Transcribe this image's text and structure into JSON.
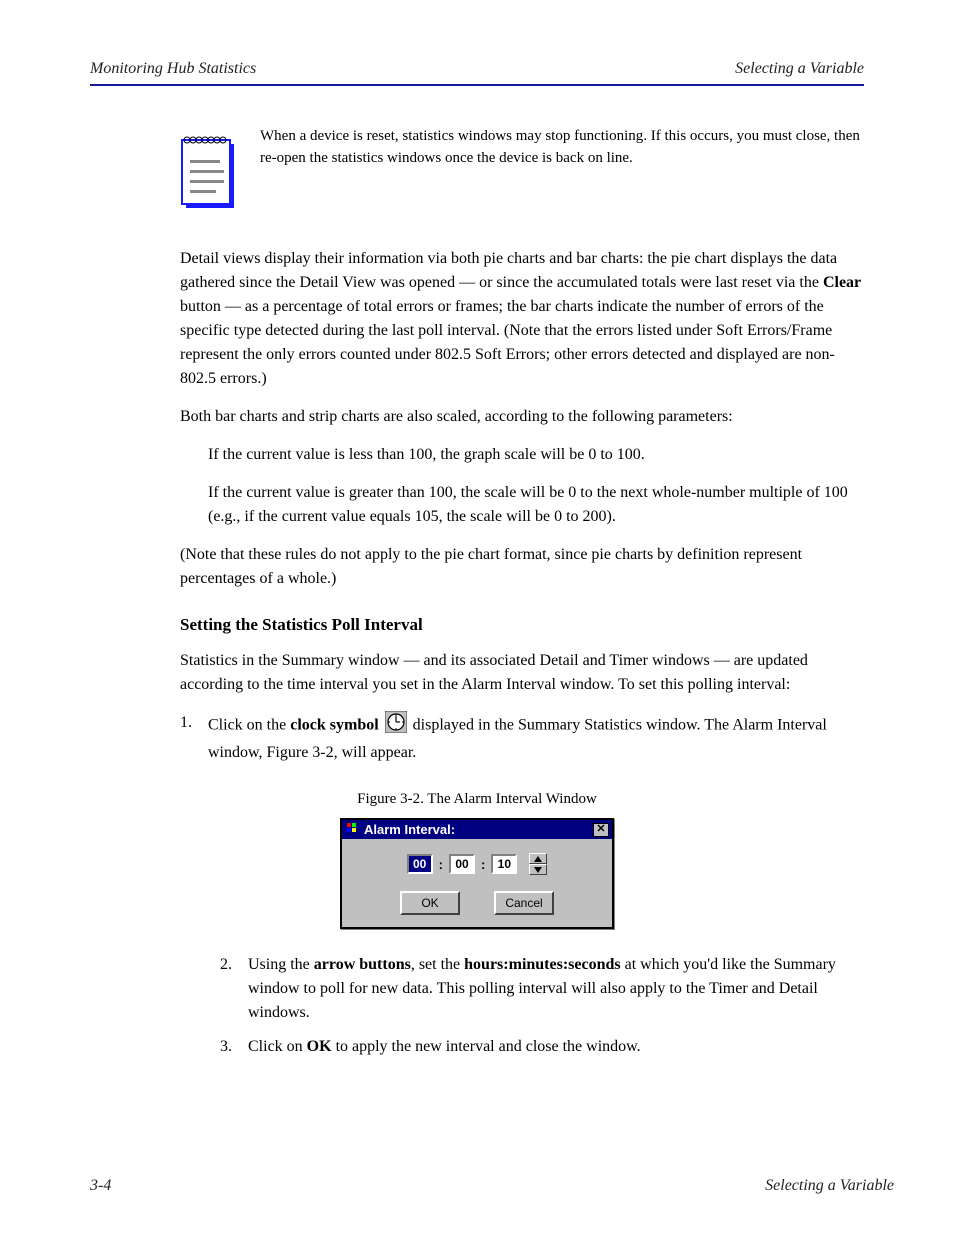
{
  "header": {
    "left": "Monitoring Hub Statistics",
    "right": "Selecting a Variable"
  },
  "note": "When a device is reset, statistics windows may stop functioning. If this occurs, you must close, then re-open the statistics windows once the device is back on line.",
  "detail_para": {
    "pre": "Detail views display their information via both pie charts and bar charts: the pie chart displays the data gathered since the Detail View was opened — or since the accumulated totals were last reset via the ",
    "bold": "Clear",
    "post": " button — as a percentage of total errors or frames; the bar charts indicate the number of errors of the specific type detected during the last poll interval. (Note that the errors listed under Soft Errors/Frame represent the only errors counted under 802.5 Soft Errors; other errors detected and displayed are non-802.5 errors.)"
  },
  "ranges_intro": "Both bar charts and strip charts are also scaled, according to the following parameters:",
  "ranges": {
    "a": "If the current value is less than 100, the graph scale will be 0 to 100.",
    "b": "If the current value is greater than 100, the scale will be 0 to the next whole-number multiple of 100 (e.g., if the current value equals 105, the scale will be 0 to 200)."
  },
  "chart_format_note": "(Note that these rules do not apply to the pie chart format, since pie charts by definition represent percentages of a whole.)",
  "setting_heading": "Setting the Statistics Poll Interval",
  "setting_intro": "Statistics in the Summary window — and its associated Detail and Timer windows — are updated according to the time interval you set in the Alarm Interval window. To set this polling interval:",
  "steps": {
    "s1_pre": "1.",
    "s1_txt_pre": "Click on the ",
    "s1_txt_bold": "clock symbol",
    "s1_txt_post": " displayed in the Summary Statistics window. The Alarm Interval window, Figure 3-2, will appear.",
    "s2_pre": "2.",
    "s2_txt_pre": "Using the ",
    "s2_txt_mid_bold": "arrow buttons",
    "s2_txt_mid": ", set the ",
    "s2_time_bold": "hours:minutes:seconds",
    "s2_txt_post": " at which you'd like the Summary window to poll for new data. This polling interval will also apply to the Timer and Detail windows.",
    "s3_pre": "3.",
    "s3_txt_pre": "Click on ",
    "s3_txt_bold": "OK",
    "s3_txt_post": " to apply the new interval and close the window."
  },
  "figure_caption": "Figure 3-2. The Alarm Interval Window",
  "dialog": {
    "title": "Alarm Interval:",
    "hh": "00",
    "mm": "00",
    "ss": "10",
    "ok": "OK",
    "cancel": "Cancel"
  },
  "footer": {
    "left": "3-4",
    "right": "Selecting a Variable"
  }
}
